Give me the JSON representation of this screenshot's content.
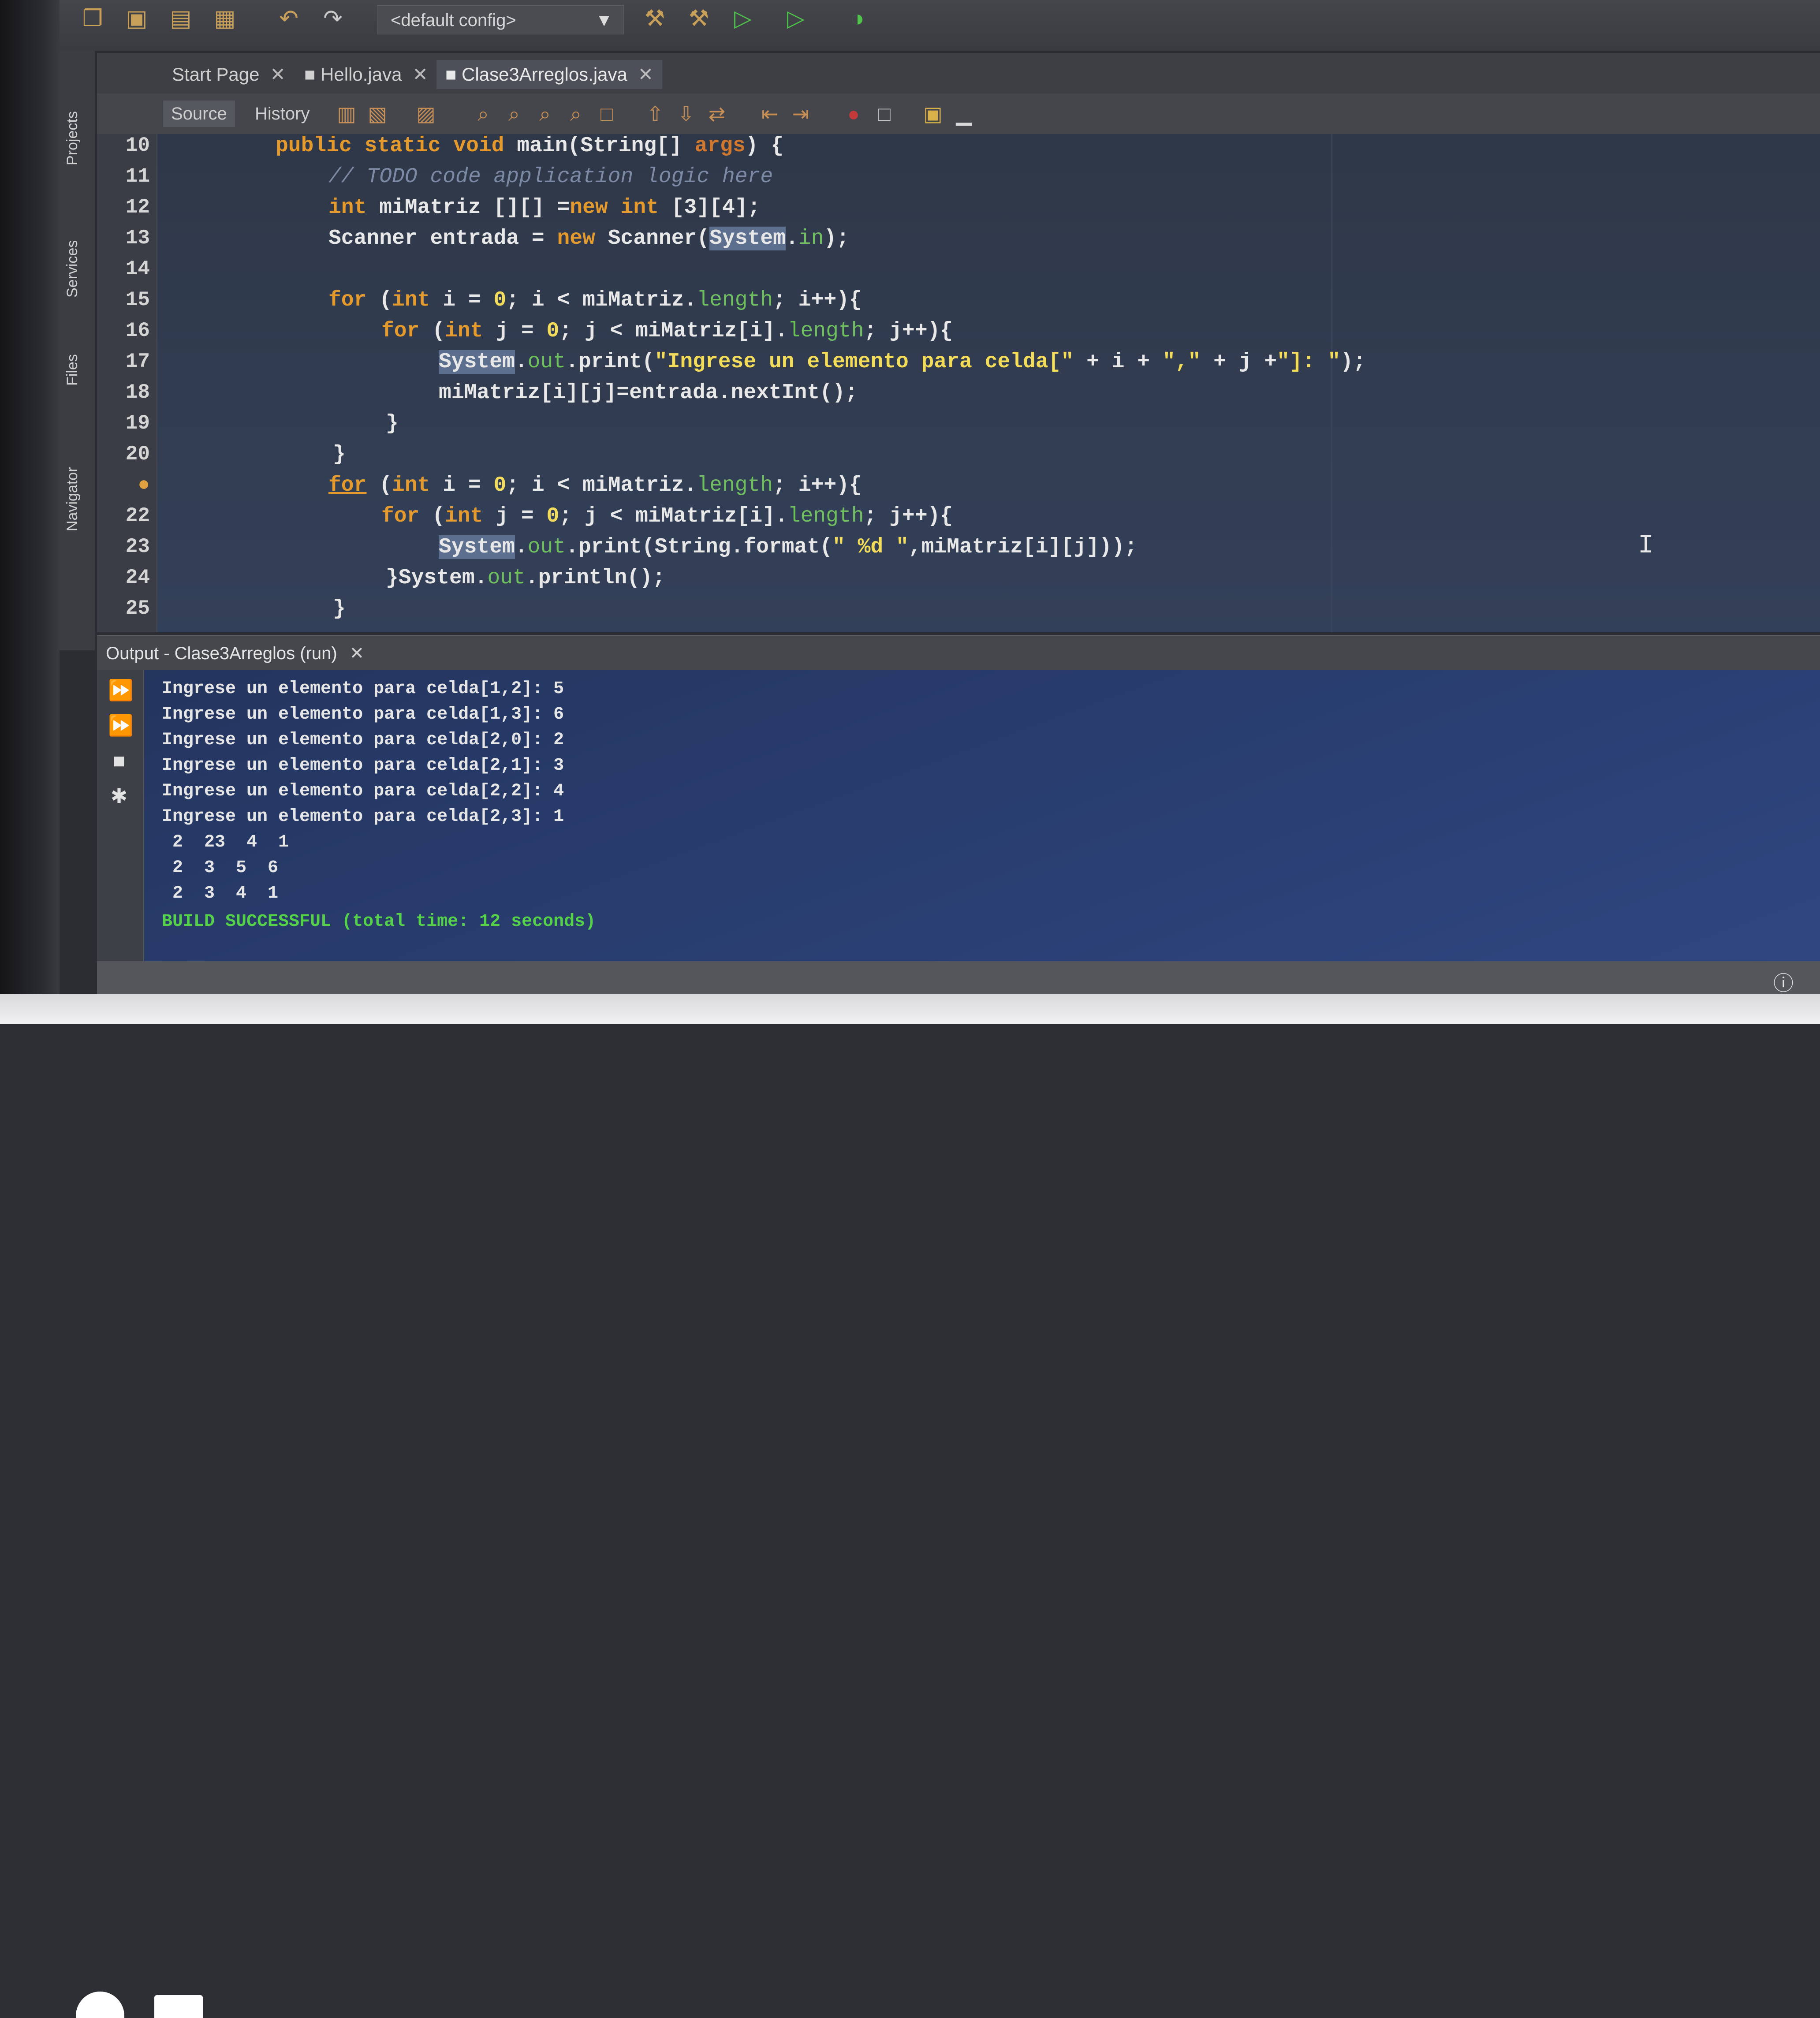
{
  "toolbar": {
    "config": "<default config>",
    "icons": [
      "new-file-icon",
      "new-project-icon",
      "open-project-icon",
      "save-all-icon",
      "undo-icon",
      "redo-icon",
      "build-icon",
      "clean-build-icon",
      "run-icon",
      "debug-icon",
      "profile-icon"
    ]
  },
  "side_tabs": [
    "Projects",
    "Services",
    "Files",
    "Navigator"
  ],
  "tabs": [
    {
      "label": "Start Page",
      "active": false
    },
    {
      "label": "Hello.java",
      "active": false
    },
    {
      "label": "Clase3Arreglos.java",
      "active": true
    }
  ],
  "subtoolbar": {
    "source": "Source",
    "history": "History"
  },
  "editor": {
    "line_numbers": [
      "10",
      "11",
      "12",
      "13",
      "14",
      "15",
      "16",
      "17",
      "18",
      "19",
      "20",
      "",
      "22",
      "23",
      "24",
      "25"
    ],
    "code": {
      "l10_a": "public static void ",
      "l10_b": "main(String[] ",
      "l10_c": "args",
      "l10_d": ") {",
      "l11": "// TODO code application logic here",
      "l12_a": "int ",
      "l12_b": "miMatriz [][] =",
      "l12_c": "new ",
      "l12_d": "int ",
      "l12_e": "[3][4];",
      "l13_a": "Scanner entrada = ",
      "l13_b": "new ",
      "l13_c": "Scanner(",
      "l13_d": "System",
      "l13_e": ".",
      "l13_f": "in",
      "l13_g": ");",
      "l15_a": "for ",
      "l15_b": "(",
      "l15_c": "int ",
      "l15_d": "i = ",
      "l15_e": "0",
      "l15_f": "; i < miMatriz.",
      "l15_g": "length",
      "l15_h": "; i++){",
      "l16_a": "for ",
      "l16_b": "(",
      "l16_c": "int ",
      "l16_d": "j = ",
      "l16_e": "0",
      "l16_f": "; j < miMatriz[i].",
      "l16_g": "length",
      "l16_h": "; j++){",
      "l17_a": "System",
      "l17_b": ".",
      "l17_c": "out",
      "l17_d": ".print(",
      "l17_e": "\"Ingrese un elemento para celda[\"",
      "l17_f": " + i + ",
      "l17_g": "\",\"",
      "l17_h": " + j +",
      "l17_i": "\"]: \"",
      "l17_j": ");",
      "l18": "miMatriz[i][j]=entrada.nextInt();",
      "l19": "}",
      "l20": "}",
      "l21_a": "for",
      "l21_b": " (",
      "l21_c": "int ",
      "l21_d": "i = ",
      "l21_e": "0",
      "l21_f": "; i < miMatriz.",
      "l21_g": "length",
      "l21_h": "; i++){",
      "l22_a": "for ",
      "l22_b": "(",
      "l22_c": "int ",
      "l22_d": "j = ",
      "l22_e": "0",
      "l22_f": "; j < miMatriz[i].",
      "l22_g": "length",
      "l22_h": "; j++){",
      "l23_a": "System",
      "l23_b": ".",
      "l23_c": "out",
      "l23_d": ".print(String.format(",
      "l23_e": "\" %d \"",
      "l23_f": ",miMatriz[i][j]));",
      "l24_a": "}System.",
      "l24_b": "out",
      "l24_c": ".println();",
      "l25": "}"
    },
    "text_cursor": "I"
  },
  "output": {
    "title": "Output - Clase3Arreglos (run)",
    "lines": [
      "Ingrese un elemento para celda[1,2]: 5",
      "Ingrese un elemento para celda[1,3]: 6",
      "Ingrese un elemento para celda[2,0]: 2",
      "Ingrese un elemento para celda[2,1]: 3",
      "Ingrese un elemento para celda[2,2]: 4",
      "Ingrese un elemento para celda[2,3]: 1",
      " 2  23  4  1",
      " 2  3  5  6",
      " 2  3  4  1"
    ],
    "result": "BUILD SUCCESSFUL (total time: 12 seconds)"
  },
  "colors": {
    "keyword": "#e59a2e",
    "string": "#f2dc5a",
    "field": "#6fbf5e",
    "comment": "#7c8aa6",
    "success": "#55d14a"
  }
}
